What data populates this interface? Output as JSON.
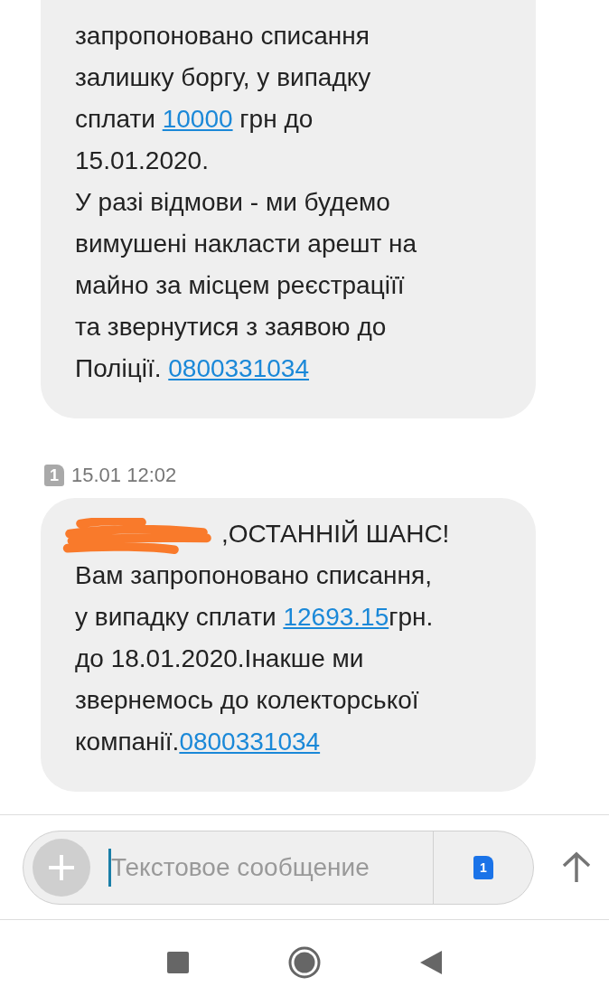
{
  "messages": [
    {
      "cut_top": true,
      "lines": [
        [
          {
            "kind": "text",
            "text": "запропоновано списання"
          }
        ],
        [
          {
            "kind": "text",
            "text": "залишку боргу, у випадку"
          }
        ],
        [
          {
            "kind": "text",
            "text": "сплати "
          },
          {
            "kind": "link",
            "text": "10000"
          },
          {
            "kind": "text",
            "text": " грн до"
          }
        ],
        [
          {
            "kind": "text",
            "text": "15.01.2020."
          }
        ],
        [
          {
            "kind": "text",
            "text": "У разі відмови - ми будемо"
          }
        ],
        [
          {
            "kind": "text",
            "text": "вимушені накласти арешт на"
          }
        ],
        [
          {
            "kind": "text",
            "text": "майно за місцем реєстраціїї"
          }
        ],
        [
          {
            "kind": "text",
            "text": "та звернутися з заявою до"
          }
        ],
        [
          {
            "kind": "text",
            "text": "Поліції. "
          },
          {
            "kind": "link",
            "text": "0800331034"
          }
        ]
      ]
    },
    {
      "cut_top": false,
      "sim_slot": "1",
      "time": "15.01 12:02",
      "lines": [
        [
          {
            "kind": "redacted"
          },
          {
            "kind": "text",
            "text": ",ОСТАННІЙ ШАНС!"
          }
        ],
        [
          {
            "kind": "text",
            "text": "Вам запропоновано списання,"
          }
        ],
        [
          {
            "kind": "text",
            "text": "у випадку сплати "
          },
          {
            "kind": "link",
            "text": "12693.15"
          },
          {
            "kind": "text",
            "text": "грн."
          }
        ],
        [
          {
            "kind": "text",
            "text": "до 18.01.2020.Інакше ми"
          }
        ],
        [
          {
            "kind": "text",
            "text": "звернемось до колекторської"
          }
        ],
        [
          {
            "kind": "text",
            "text": "компанії."
          },
          {
            "kind": "link",
            "text": "0800331034"
          }
        ]
      ]
    }
  ],
  "composer": {
    "placeholder": "Текстовое сообщение",
    "sim_slot": "1"
  }
}
